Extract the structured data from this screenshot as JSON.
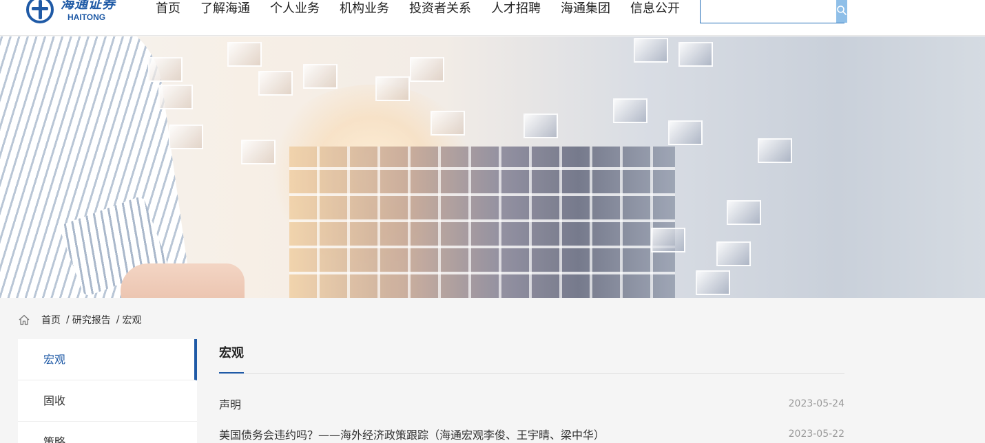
{
  "header": {
    "logo_cn": "海通证券",
    "logo_en": "HAITONG",
    "nav": [
      "首页",
      "了解海通",
      "个人业务",
      "机构业务",
      "投资者关系",
      "人才招聘",
      "海通集团",
      "信息公开"
    ],
    "search": {
      "value": "",
      "placeholder": ""
    }
  },
  "breadcrumb": {
    "home": "首页",
    "sep": "/",
    "level2": "研究报告",
    "current": "宏观"
  },
  "sidebar": {
    "items": [
      "宏观",
      "固收",
      "策略"
    ],
    "active_index": 0
  },
  "content": {
    "title": "宏观",
    "list": [
      {
        "title": "声明",
        "date": "2023-05-24"
      },
      {
        "title": "美国债务会违约吗？——海外经济政策跟踪（海通宏观李俊、王宇晴、梁中华）",
        "date": "2023-05-22"
      }
    ]
  },
  "colors": {
    "brand": "#1f5aa6",
    "search_button": "#8fbfe8",
    "page_bg": "#f5f5f5"
  },
  "icons": {
    "logo": "haitong-logo-icon",
    "search": "search-icon",
    "home": "home-icon"
  }
}
